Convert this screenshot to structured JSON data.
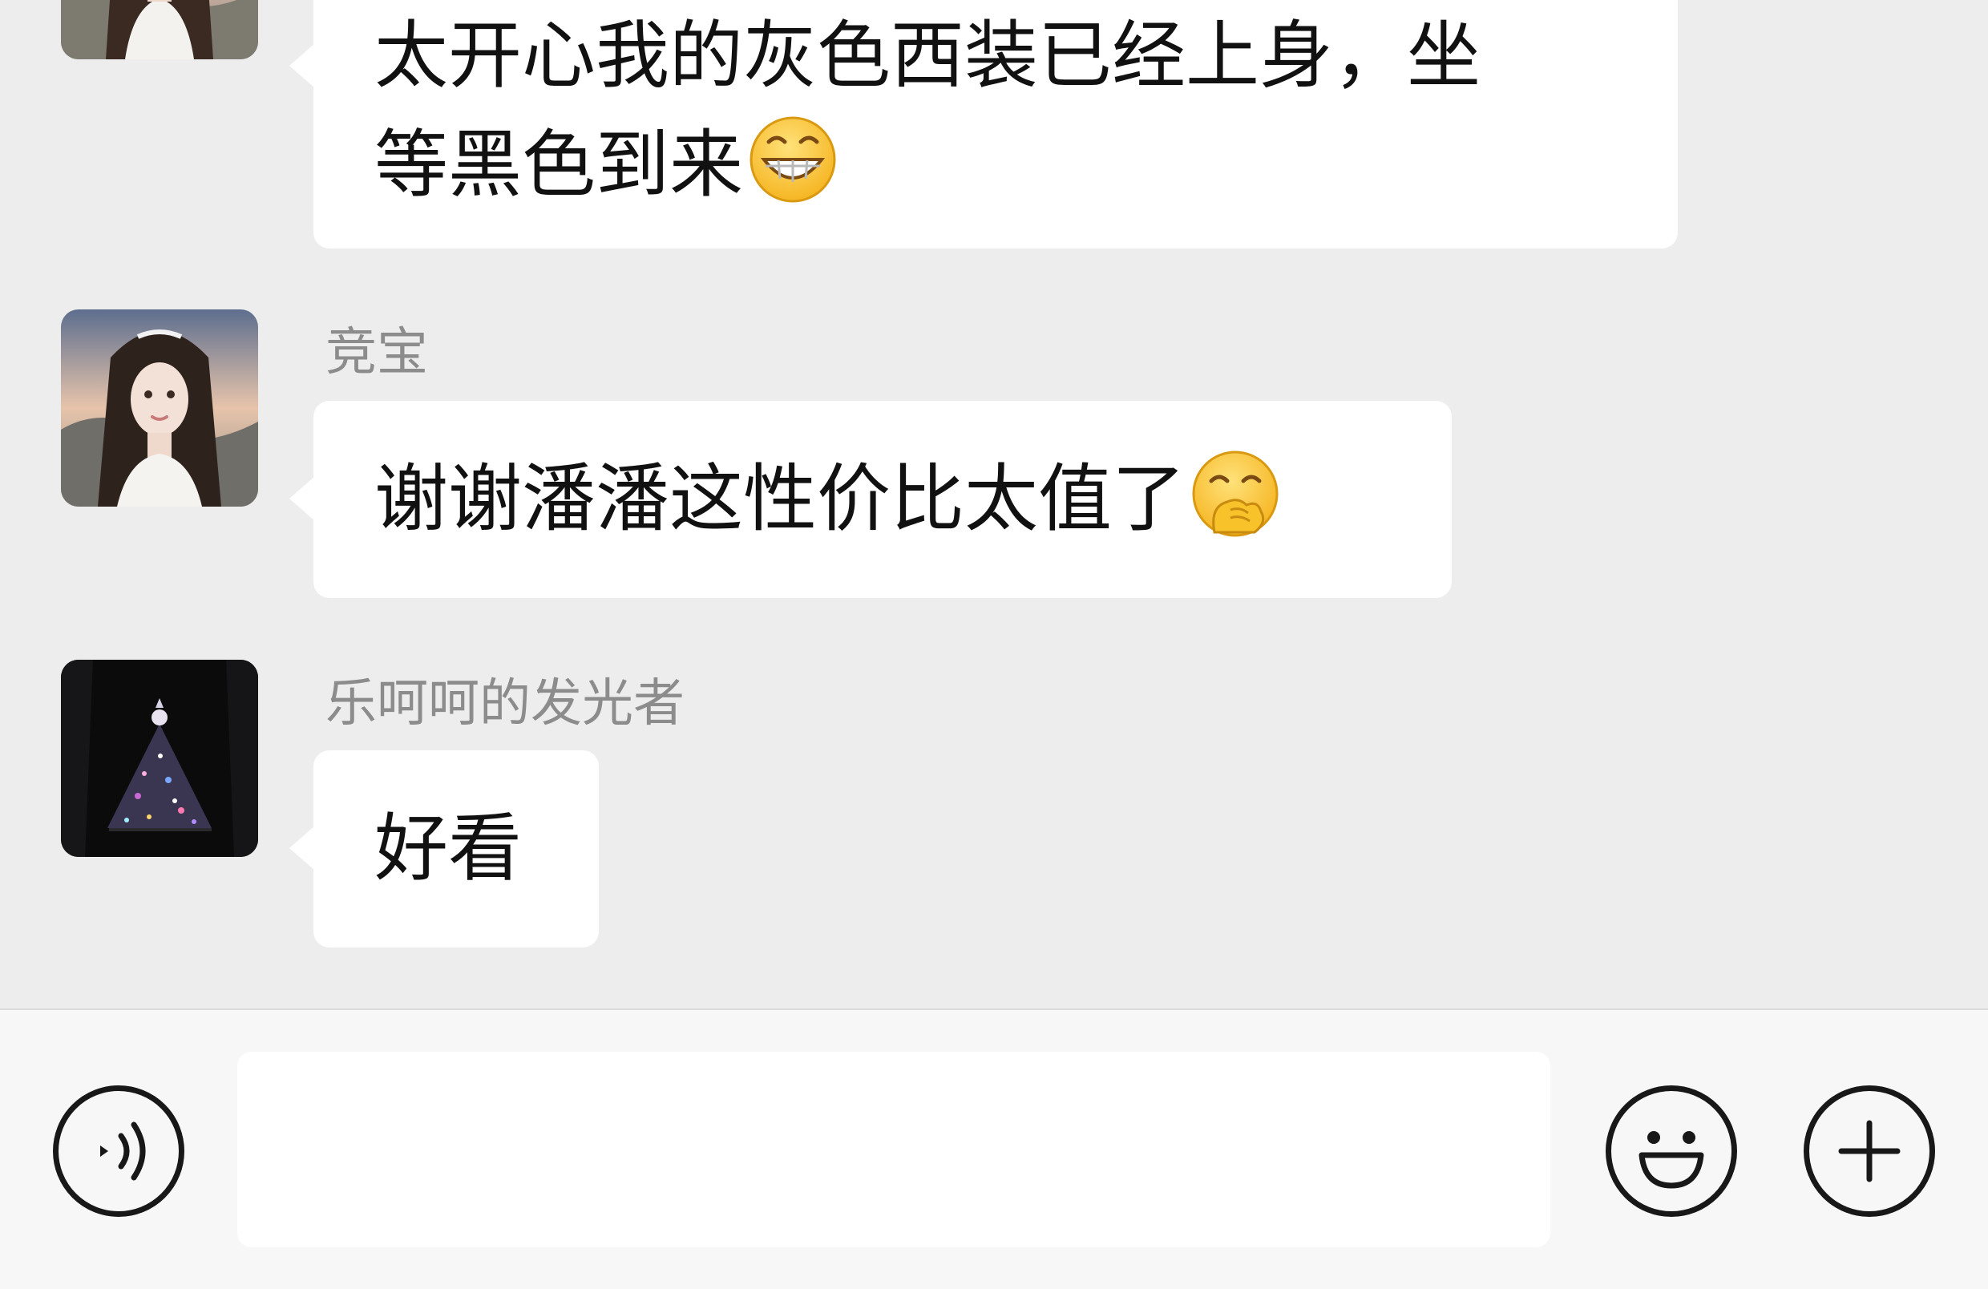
{
  "messages": [
    {
      "sender": "",
      "lines": [
        "太开心我的灰色西装已经上身，坐",
        "等黑色到来"
      ],
      "emoji": "grinning-face-emoji"
    },
    {
      "sender": "竞宝",
      "lines": [
        "谢谢潘潘这性价比太值了"
      ],
      "emoji": "face-with-hand-over-mouth-emoji"
    },
    {
      "sender": "乐呵呵的发光者",
      "lines": [
        "好看"
      ],
      "emoji": ""
    }
  ],
  "input_bar": {
    "voice_icon": "voice-icon",
    "text_value": "",
    "emoji_icon": "smiley-face-icon",
    "plus_icon": "plus-icon"
  },
  "colors": {
    "chat_background": "#ededed",
    "bubble": "#ffffff",
    "input_bar": "#f7f7f7",
    "sender_name": "#8c8c8c"
  }
}
